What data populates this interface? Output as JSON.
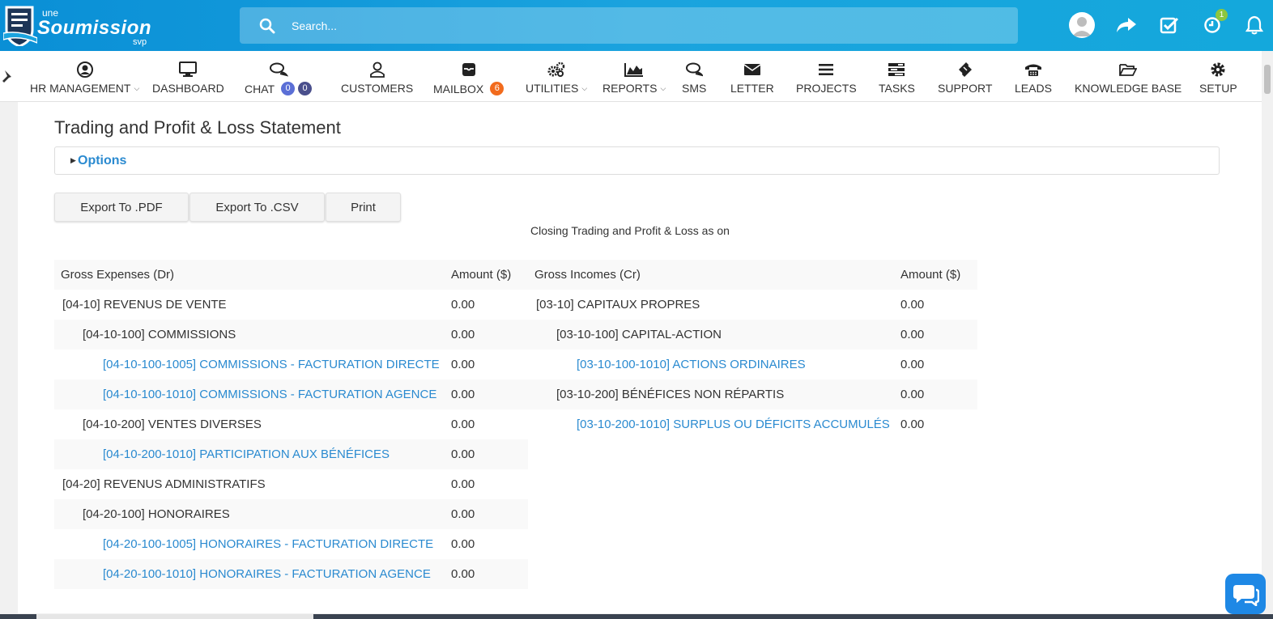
{
  "header": {
    "logo": {
      "line1": "une",
      "brand": "Soumission",
      "line3": "svp"
    },
    "search": {
      "placeholder": "Search..."
    },
    "notifications_count": "1",
    "colors": {
      "header_bg": "#0a8fd6",
      "link": "#2a8ad0",
      "badge_green": "#8dc63f"
    }
  },
  "nav": {
    "items": [
      {
        "label": "HR MANAGEMENT",
        "icon": "user-circle-icon",
        "caret": "⌵"
      },
      {
        "label": "DASHBOARD",
        "icon": "monitor-icon"
      },
      {
        "label": "CHAT",
        "icon": "chat-bubbles-icon",
        "badge1": "0",
        "badge2": "0"
      },
      {
        "label": "CUSTOMERS",
        "icon": "user-outline-icon"
      },
      {
        "label": "MAILBOX",
        "icon": "inbox-icon",
        "badge": "6"
      },
      {
        "label": "UTILITIES",
        "icon": "cogs-icon",
        "caret": "⌵"
      },
      {
        "label": "REPORTS",
        "icon": "area-chart-icon",
        "caret": "⌵"
      },
      {
        "label": "SMS",
        "icon": "sms-bubbles-icon"
      },
      {
        "label": "LETTER",
        "icon": "envelope-icon"
      },
      {
        "label": "PROJECTS",
        "icon": "bars-icon"
      },
      {
        "label": "TASKS",
        "icon": "tasks-icon"
      },
      {
        "label": "SUPPORT",
        "icon": "ticket-icon"
      },
      {
        "label": "LEADS",
        "icon": "phone-icon"
      },
      {
        "label": "KNOWLEDGE BASE",
        "icon": "folder-open-icon"
      },
      {
        "label": "SETUP",
        "icon": "gear-icon"
      }
    ]
  },
  "page": {
    "title": "Trading and Profit & Loss Statement",
    "options_label": "Options",
    "buttons": {
      "pdf": "Export To .PDF",
      "csv": "Export To .CSV",
      "print": "Print"
    },
    "closing_text": "Closing Trading and Profit & Loss as on"
  },
  "expenses": {
    "header_name": "Gross Expenses (Dr)",
    "header_amount": "Amount ($)",
    "rows": [
      {
        "name": "[04-10] REVENUS DE VENTE",
        "amount": "0.00"
      },
      {
        "name": "[04-10-100] COMMISSIONS",
        "amount": "0.00"
      },
      {
        "name": "[04-10-100-1005] COMMISSIONS - FACTURATION DIRECTE",
        "amount": "0.00"
      },
      {
        "name": "[04-10-100-1010] COMMISSIONS - FACTURATION AGENCE",
        "amount": "0.00"
      },
      {
        "name": "[04-10-200] VENTES DIVERSES",
        "amount": "0.00"
      },
      {
        "name": "[04-10-200-1010] PARTICIPATION AUX BÉNÉFICES",
        "amount": "0.00"
      },
      {
        "name": "[04-20] REVENUS ADMINISTRATIFS",
        "amount": "0.00"
      },
      {
        "name": "[04-20-100] HONORAIRES",
        "amount": "0.00"
      },
      {
        "name": "[04-20-100-1005] HONORAIRES - FACTURATION DIRECTE",
        "amount": "0.00"
      },
      {
        "name": "[04-20-100-1010] HONORAIRES - FACTURATION AGENCE",
        "amount": "0.00"
      }
    ]
  },
  "incomes": {
    "header_name": "Gross Incomes (Cr)",
    "header_amount": "Amount ($)",
    "rows": [
      {
        "name": "[03-10] CAPITAUX PROPRES",
        "amount": "0.00"
      },
      {
        "name": "[03-10-100] CAPITAL-ACTION",
        "amount": "0.00"
      },
      {
        "name": "[03-10-100-1010] ACTIONS ORDINAIRES",
        "amount": "0.00"
      },
      {
        "name": "[03-10-200] BÉNÉFICES NON RÉPARTIS",
        "amount": "0.00"
      },
      {
        "name": "[03-10-200-1010] SURPLUS OU DÉFICITS ACCUMULÉS",
        "amount": "0.00"
      }
    ]
  }
}
